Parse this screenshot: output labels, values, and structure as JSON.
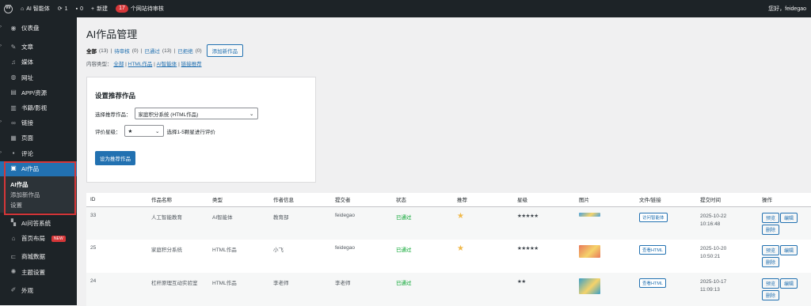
{
  "adminbar": {
    "site_name": "AI 智能体",
    "updates": "1",
    "comments": "0",
    "new_label": "新建",
    "badge_count": "17",
    "badge_text": "个网站待审核",
    "greeting": "您好，feidegao"
  },
  "sidebar": {
    "items": [
      {
        "label": "仪表盘",
        "icon": "gauge-icon"
      },
      {
        "label": "文章",
        "icon": "pin-icon"
      },
      {
        "label": "媒体",
        "icon": "media-icon"
      },
      {
        "label": "网址",
        "icon": "globe-icon"
      },
      {
        "label": "APP/资源",
        "icon": "folder-icon"
      },
      {
        "label": "书籍/影视",
        "icon": "book-icon"
      },
      {
        "label": "链接",
        "icon": "link-icon"
      },
      {
        "label": "页面",
        "icon": "page-icon"
      },
      {
        "label": "评论",
        "icon": "comment-icon"
      }
    ],
    "active_label": "AI作品",
    "submenu": [
      "AI作品",
      "添加新作品",
      "设置"
    ],
    "lower_items": [
      {
        "label": "AI问答系统",
        "icon": "qa-icon"
      },
      {
        "label": "首页布局",
        "icon": "home-icon",
        "badge": "NEW"
      },
      {
        "label": "商城数据",
        "icon": "cart-icon"
      },
      {
        "label": "主题设置",
        "icon": "gear-icon"
      },
      {
        "label": "外观",
        "icon": "brush-icon"
      }
    ]
  },
  "page": {
    "title": "AI作品管理",
    "filters": {
      "all": "全部",
      "all_count": "(13)",
      "pending": "待审核",
      "pending_count": "(0)",
      "approved": "已通过",
      "approved_count": "(13)",
      "rejected": "已拒绝",
      "rejected_count": "(0)"
    },
    "add_button": "添加新作品",
    "type_filter_label": "内容类型：",
    "type_filters": [
      "全部",
      "HTML作品",
      "AI智能体",
      "链接推荐"
    ]
  },
  "recommend": {
    "title": "设置推荐作品",
    "select_label": "选择推荐作品：",
    "select_value": "家庭积分系统 (HTML作品)",
    "rating_label": "评价星级：",
    "rating_value": "★",
    "rating_hint": "选择1-5颗星进行评价",
    "submit": "设为推荐作品"
  },
  "table": {
    "headers": [
      "ID",
      "作品名称",
      "类型",
      "作者信息",
      "提交者",
      "状态",
      "推荐",
      "星级",
      "图片",
      "文件/链接",
      "提交时间",
      "操作"
    ],
    "rows": [
      {
        "id": "33",
        "name": "人工智能教育",
        "type": "AI智能体",
        "author": "教育部",
        "submitter": "feidegao",
        "status": "已通过",
        "stars": "★★★★★",
        "file_btn": "访问智能体",
        "date": "2025-10-22",
        "time": "10:16:48",
        "thumb_color": "#4aa3df"
      },
      {
        "id": "25",
        "name": "家庭积分系统",
        "type": "HTML作品",
        "author": "小飞",
        "submitter": "feidegao",
        "status": "已通过",
        "stars": "★★★★★",
        "file_btn": "查看HTML",
        "date": "2025-10-20",
        "time": "10:50:21",
        "thumb_color": "#e8795a"
      },
      {
        "id": "24",
        "name": "杠杆原理互动实验室",
        "type": "HTML作品",
        "author": "李老师",
        "submitter": "李老师",
        "status": "已通过",
        "stars": "★★",
        "file_btn": "查看HTML",
        "date": "2025-10-17",
        "time": "11:09:13",
        "thumb_color": "#3aa0c8"
      }
    ],
    "actions": {
      "preview": "预览",
      "edit": "编辑",
      "delete": "删除"
    }
  }
}
